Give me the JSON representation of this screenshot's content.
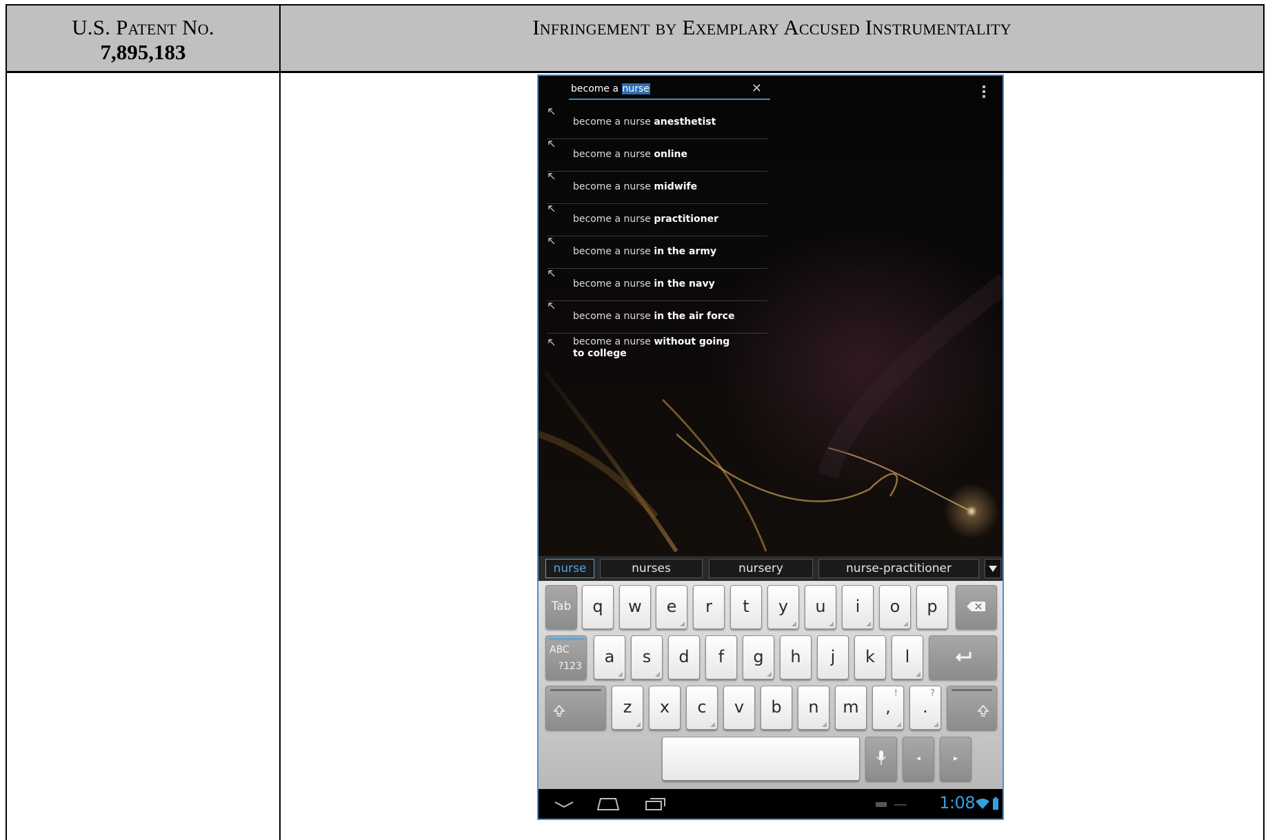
{
  "document": {
    "header_left_line1": "U.S. Patent No.",
    "header_left_line2": "7,895,183",
    "header_right": "Infringement by Exemplary Accused Instrumentality"
  },
  "device": {
    "search": {
      "text_prefix": "become a ",
      "text_selected": "nurse"
    },
    "suggestions": [
      {
        "prefix": "become a nurse ",
        "completion": "anesthetist"
      },
      {
        "prefix": "become a nurse ",
        "completion": "online"
      },
      {
        "prefix": "become a nurse ",
        "completion": "midwife"
      },
      {
        "prefix": "become a nurse ",
        "completion": "practitioner"
      },
      {
        "prefix": "become a nurse ",
        "completion": "in the army"
      },
      {
        "prefix": "become a nurse ",
        "completion": "in the navy"
      },
      {
        "prefix": "become a nurse ",
        "completion": "in the air force"
      },
      {
        "prefix": "become a nurse ",
        "completion": "without going to college"
      }
    ],
    "candidates": [
      "nurse",
      "nurses",
      "nursery",
      "nurse-practitioner"
    ],
    "keyboard": {
      "row1": [
        "q",
        "w",
        "e",
        "r",
        "t",
        "y",
        "u",
        "i",
        "o",
        "p"
      ],
      "row2": [
        "a",
        "s",
        "d",
        "f",
        "g",
        "h",
        "j",
        "k",
        "l"
      ],
      "row3": [
        "z",
        "x",
        "c",
        "v",
        "b",
        "n",
        "m",
        ",",
        "."
      ],
      "tab_label": "Tab",
      "sym_label_top": "ABC",
      "sym_label_bottom": "?123",
      "comma_hint": "!",
      "period_hint": "?"
    },
    "system_bar": {
      "clock": "1:08"
    },
    "colors": {
      "accent": "#35a0e0",
      "selection": "#2e6fb2",
      "header_gray": "#c0c0c0"
    }
  }
}
